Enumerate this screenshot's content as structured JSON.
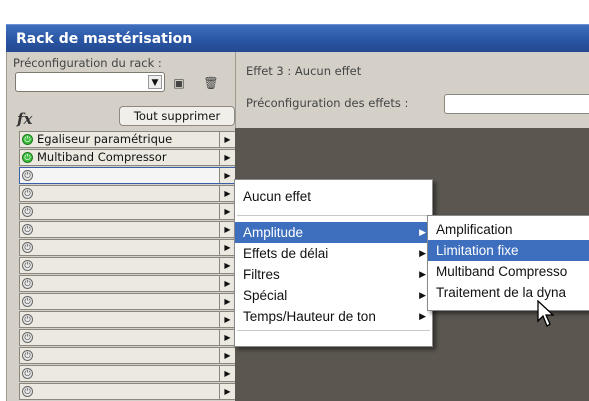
{
  "window": {
    "title": "Rack de mastérisation"
  },
  "left": {
    "preset_label": "Préconfiguration du rack :",
    "preset_value": "",
    "fx_label": "fx",
    "clear_button": "Tout supprimer",
    "slots": [
      {
        "name": "Egaliseur paramétrique",
        "power": "on"
      },
      {
        "name": "Multiband Compressor",
        "power": "on"
      },
      {
        "name": "",
        "power": "off",
        "selected": true
      },
      {
        "name": "",
        "power": "off"
      },
      {
        "name": "",
        "power": "off"
      },
      {
        "name": "",
        "power": "off"
      },
      {
        "name": "",
        "power": "off"
      },
      {
        "name": "",
        "power": "off"
      },
      {
        "name": "",
        "power": "off"
      },
      {
        "name": "",
        "power": "off"
      },
      {
        "name": "",
        "power": "off"
      },
      {
        "name": "",
        "power": "off"
      },
      {
        "name": "",
        "power": "off"
      },
      {
        "name": "",
        "power": "off"
      },
      {
        "name": "",
        "power": "off"
      },
      {
        "name": "",
        "power": "off"
      }
    ]
  },
  "right": {
    "effect_title": "Effet 3 : Aucun effet",
    "effect_preset_label": "Préconfiguration des effets :",
    "effect_preset_value": ""
  },
  "menu": {
    "top_item": "Aucun effet",
    "items": [
      "Amplitude",
      "Effets de délai",
      "Filtres",
      "Spécial",
      "Temps/Hauteur de ton"
    ],
    "highlighted": "Amplitude"
  },
  "submenu": {
    "items": [
      "Amplification",
      "Limitation fixe",
      "Multiband Compresso",
      "Traitement de la dyna"
    ],
    "highlighted": "Limitation fixe"
  },
  "colors": {
    "title_bar": "#2a56a4",
    "highlight": "#3d6fbe",
    "rack_bg": "#d4d0c8",
    "dark_area": "#5b5750"
  }
}
